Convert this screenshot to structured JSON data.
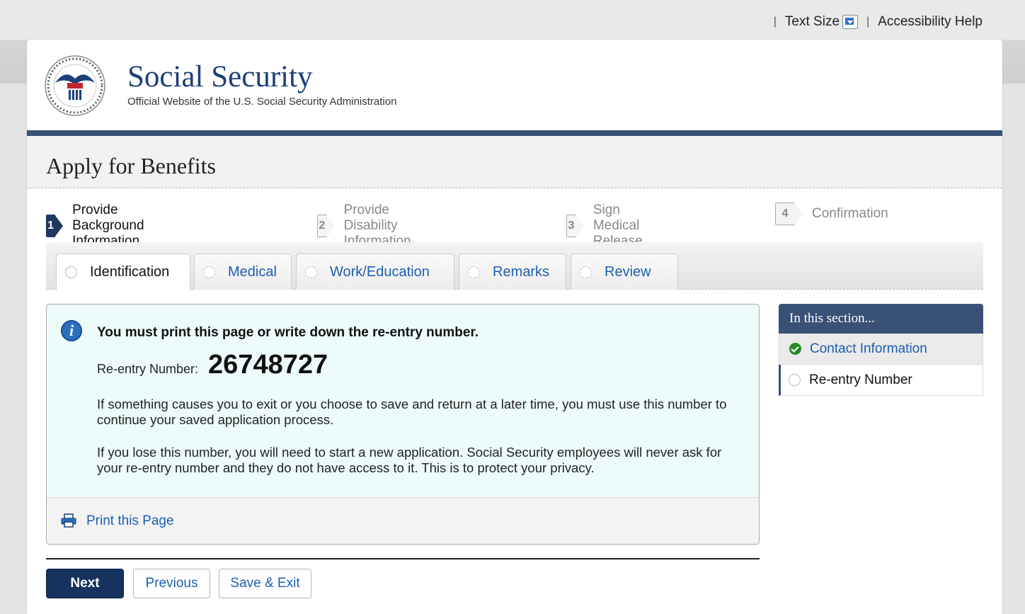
{
  "utility": {
    "text_size": "Text Size",
    "accessibility": "Accessibility Help",
    "separator": "|"
  },
  "brand": {
    "title": "Social Security",
    "subtitle": "Official Website of the U.S. Social Security Administration"
  },
  "page_title": "Apply for Benefits",
  "steps": [
    {
      "num": "1",
      "label": "Provide Background Information",
      "active": true
    },
    {
      "num": "2",
      "label": "Provide Disability Information",
      "active": false
    },
    {
      "num": "3",
      "label": "Sign Medical Release",
      "active": false
    },
    {
      "num": "4",
      "label": "Confirmation",
      "active": false
    }
  ],
  "tabs": [
    {
      "label": "Identification",
      "active": true
    },
    {
      "label": "Medical",
      "active": false
    },
    {
      "label": "Work/Education",
      "active": false
    },
    {
      "label": "Remarks",
      "active": false
    },
    {
      "label": "Review",
      "active": false
    }
  ],
  "notice": {
    "warning": "You must print this page or write down the re-entry number.",
    "reentry_label": "Re-entry Number:",
    "reentry_number": "26748727",
    "para1": "If something causes you to exit or you choose to save and return at a later time, you must use this number to continue your saved application process.",
    "para2": "If you lose this number, you will need to start a new application. Social Security employees will never ask for your re-entry number and they do not have access to it. This is to protect your privacy.",
    "print_link": "Print this Page"
  },
  "buttons": {
    "next": "Next",
    "previous": "Previous",
    "save_exit": "Save & Exit"
  },
  "sidebar": {
    "heading": "In this section...",
    "items": [
      {
        "label": "Contact Information",
        "status": "complete"
      },
      {
        "label": "Re-entry Number",
        "status": "current"
      }
    ]
  },
  "colors": {
    "navy": "#1f3660",
    "link": "#1b5fb0",
    "info_bg": "#eefbfb",
    "check_green": "#2b8a2b"
  }
}
